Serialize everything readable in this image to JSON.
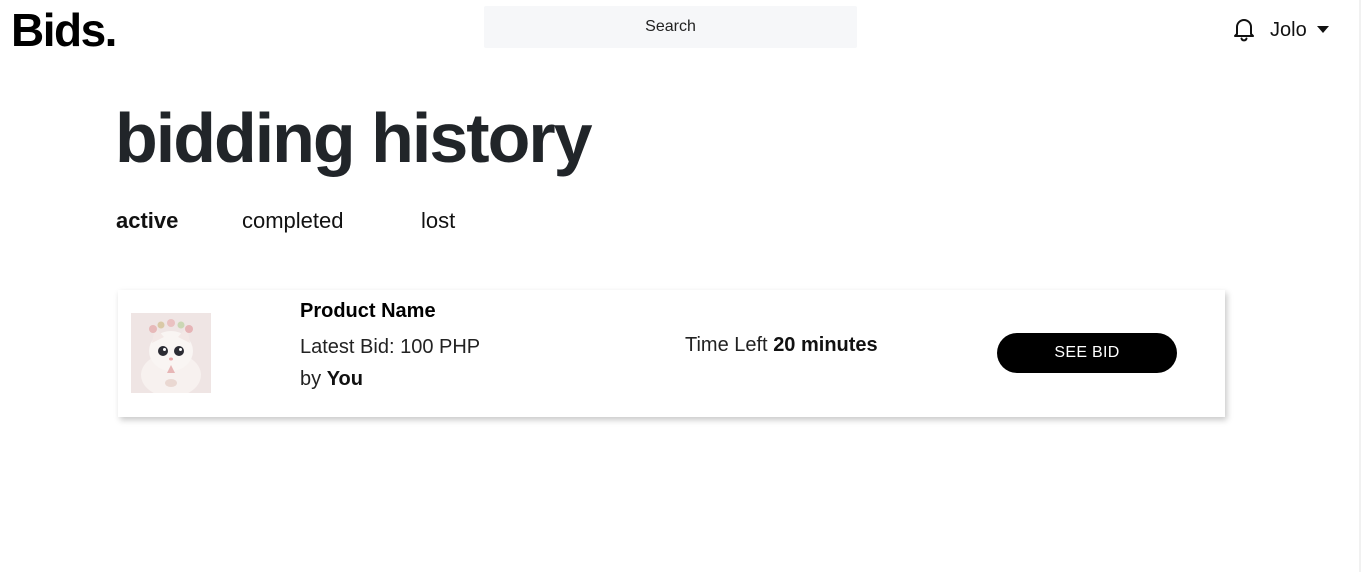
{
  "header": {
    "logo": "Bids.",
    "search_placeholder": "Search",
    "notification_icon": "bell-icon",
    "user_name": "Jolo",
    "user_menu_icon": "caret-down-icon"
  },
  "page": {
    "title": "bidding history"
  },
  "tabs": [
    {
      "label": "active",
      "selected": true
    },
    {
      "label": "completed",
      "selected": false
    },
    {
      "label": "lost",
      "selected": false
    }
  ],
  "bids": [
    {
      "image": "cat-with-flower-crown-photo",
      "product_name": "Product Name",
      "latest_bid_label": "Latest Bid:",
      "latest_bid_value": "100 PHP",
      "by_label": "by",
      "by_value": "You",
      "time_left_label": "Time Left",
      "time_left_value": "20 minutes",
      "action_label": "SEE BID"
    }
  ],
  "colors": {
    "accent": "#000000",
    "search_bg": "#f6f7f9",
    "text": "#212529"
  }
}
